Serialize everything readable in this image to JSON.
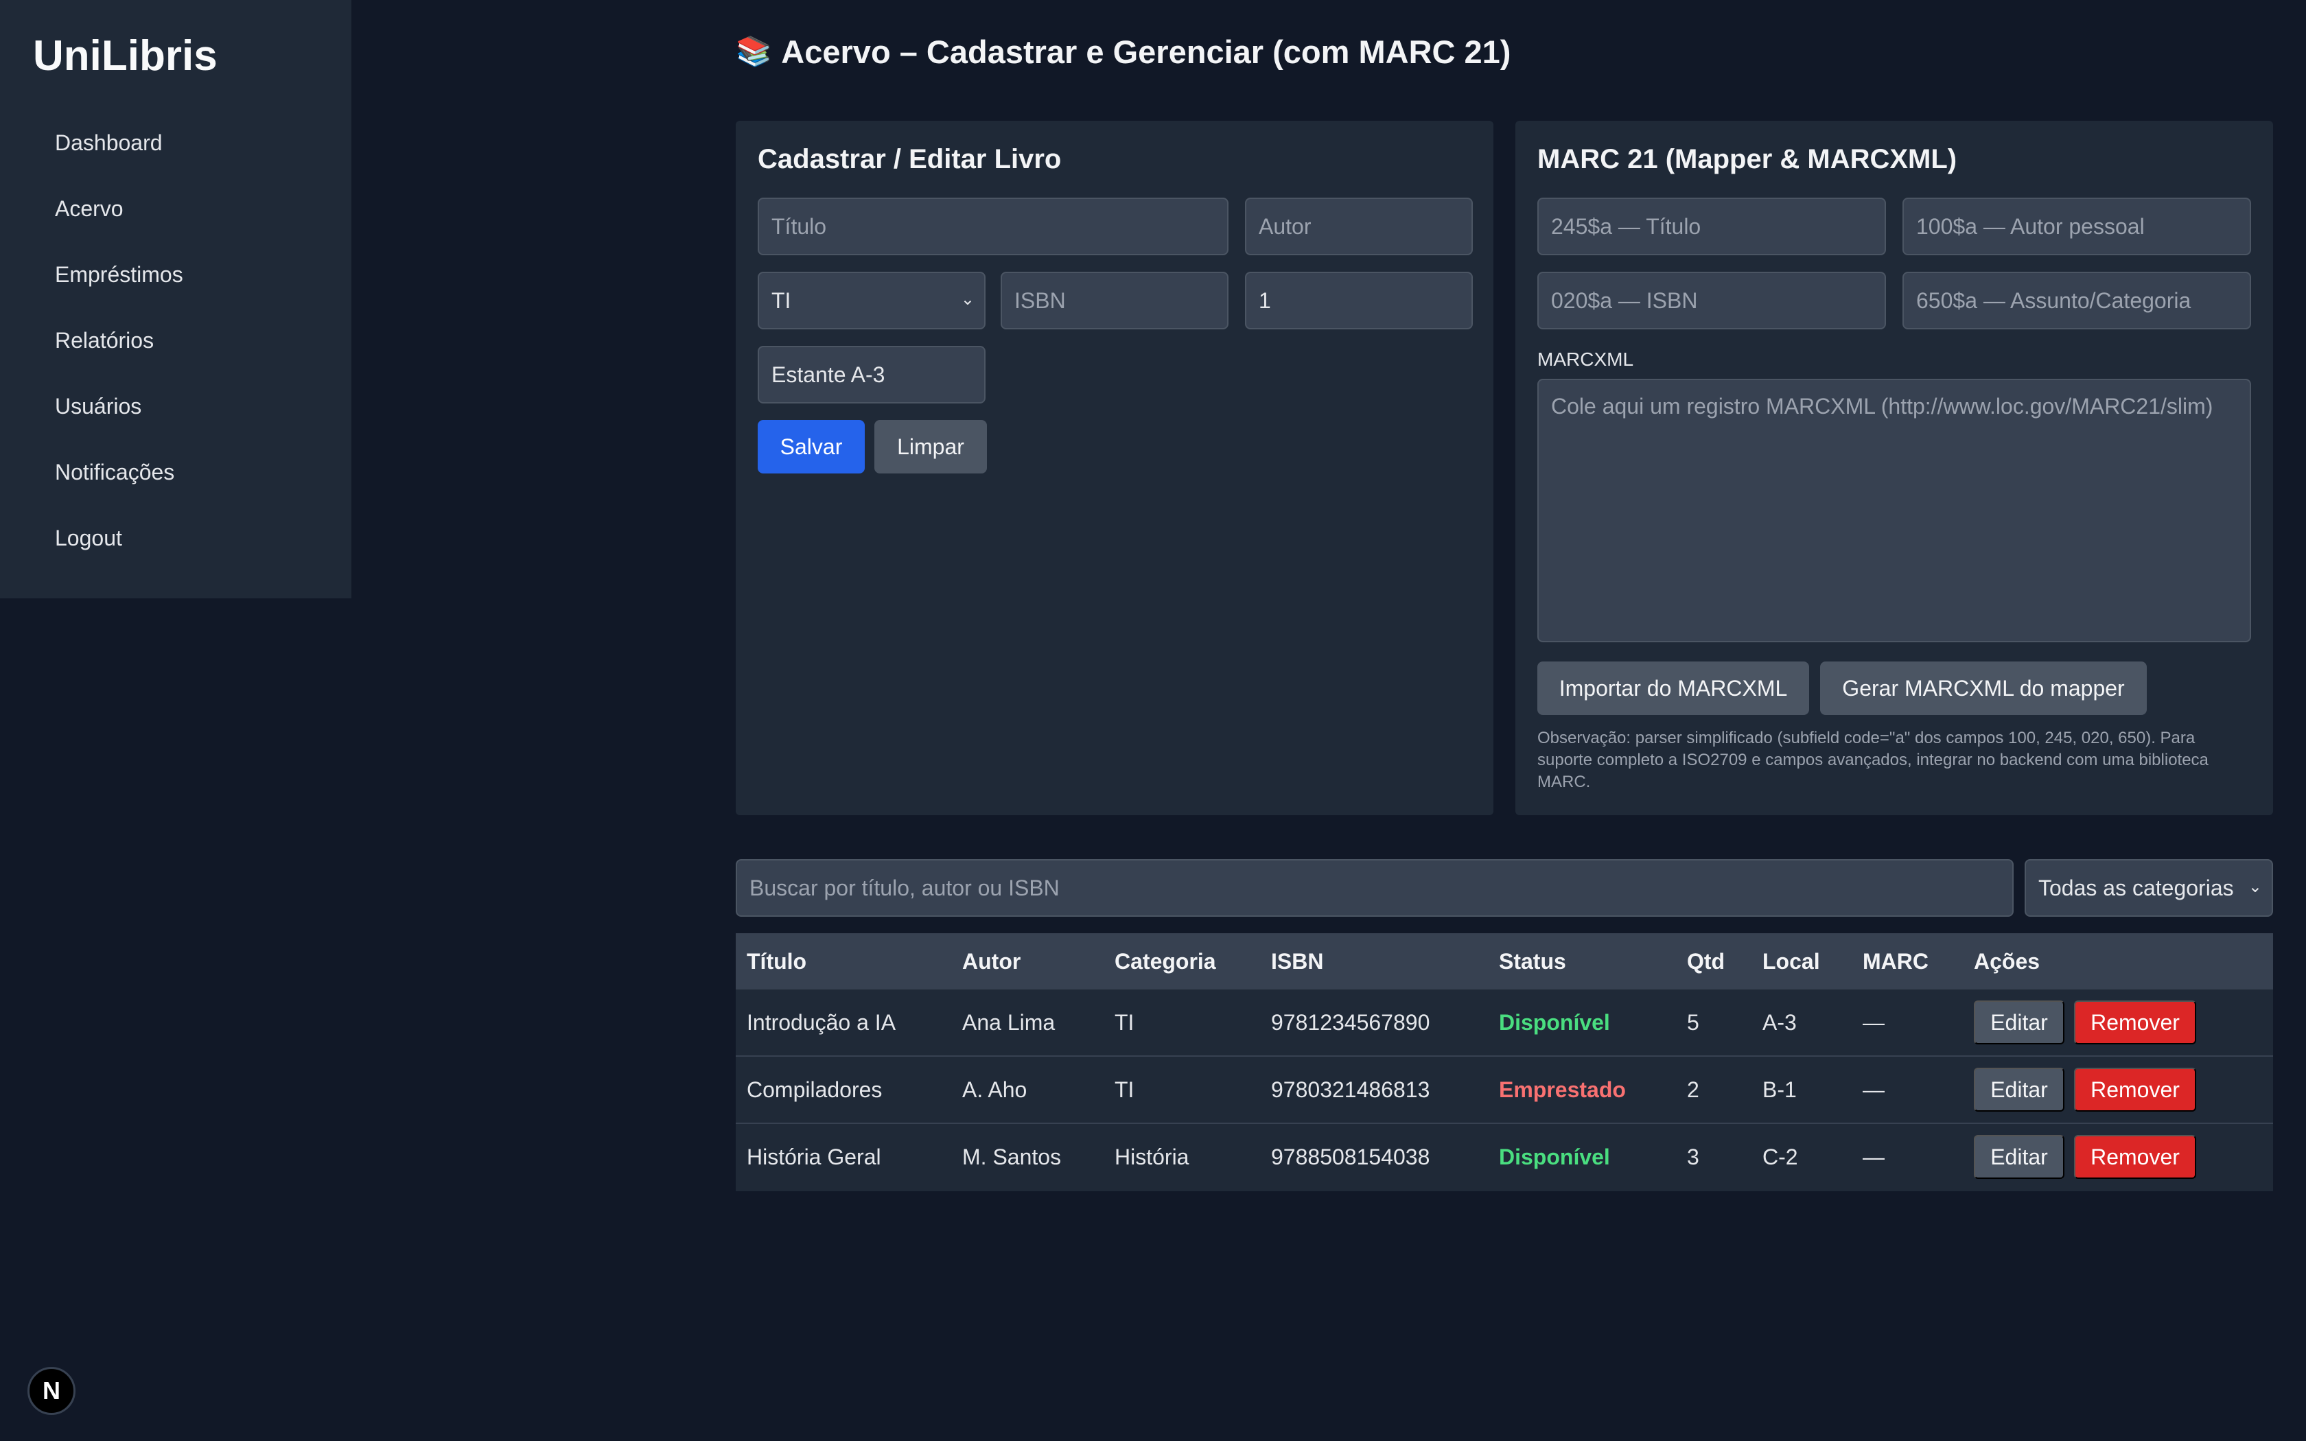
{
  "app": {
    "brand": "UniLibris"
  },
  "sidebar": {
    "items": [
      {
        "label": "Dashboard"
      },
      {
        "label": "Acervo"
      },
      {
        "label": "Empréstimos"
      },
      {
        "label": "Relatórios"
      },
      {
        "label": "Usuários"
      },
      {
        "label": "Notificações"
      },
      {
        "label": "Logout"
      }
    ]
  },
  "header": {
    "icon": "📚",
    "title": "Acervo – Cadastrar e Gerenciar (com MARC 21)"
  },
  "form": {
    "title": "Cadastrar / Editar Livro",
    "titulo_placeholder": "Título",
    "autor_placeholder": "Autor",
    "categoria_value": "TI",
    "isbn_placeholder": "ISBN",
    "quantidade_value": "1",
    "local_value": "Estante A-3",
    "save_label": "Salvar",
    "clear_label": "Limpar"
  },
  "marc": {
    "title": "MARC 21 (Mapper & MARCXML)",
    "f245_placeholder": "245$a — Título",
    "f100_placeholder": "100$a — Autor pessoal",
    "f020_placeholder": "020$a — ISBN",
    "f650_placeholder": "650$a — Assunto/Categoria",
    "marcxml_label": "MARCXML",
    "marcxml_placeholder": "Cole aqui um registro MARCXML (http://www.loc.gov/MARC21/slim)",
    "import_label": "Importar do MARCXML",
    "generate_label": "Gerar MARCXML do mapper",
    "note": "Observação: parser simplificado (subfield code=\"a\" dos campos 100, 245, 020, 650). Para suporte completo a ISO2709 e campos avançados, integrar no backend com uma biblioteca MARC."
  },
  "search": {
    "placeholder": "Buscar por título, autor ou ISBN",
    "filter_value": "Todas as categorias"
  },
  "table": {
    "headers": {
      "titulo": "Título",
      "autor": "Autor",
      "categoria": "Categoria",
      "isbn": "ISBN",
      "status": "Status",
      "qtd": "Qtd",
      "local": "Local",
      "marc": "MARC",
      "acoes": "Ações"
    },
    "edit_label": "Editar",
    "remove_label": "Remover",
    "rows": [
      {
        "titulo": "Introdução a IA",
        "autor": "Ana Lima",
        "categoria": "TI",
        "isbn": "9781234567890",
        "status": "Disponível",
        "qtd": "5",
        "local": "A-3",
        "marc": "—"
      },
      {
        "titulo": "Compiladores",
        "autor": "A. Aho",
        "categoria": "TI",
        "isbn": "9780321486813",
        "status": "Emprestado",
        "qtd": "2",
        "local": "B-1",
        "marc": "—"
      },
      {
        "titulo": "História Geral",
        "autor": "M. Santos",
        "categoria": "História",
        "isbn": "9788508154038",
        "status": "Disponível",
        "qtd": "3",
        "local": "C-2",
        "marc": "—"
      }
    ]
  },
  "dev_badge": {
    "letter": "N"
  },
  "colors": {
    "background": "#111827",
    "panel": "#1f2937",
    "input": "#374151",
    "primary": "#2563eb",
    "danger": "#dc2626",
    "available": "#4ade80",
    "borrowed": "#f87171"
  }
}
